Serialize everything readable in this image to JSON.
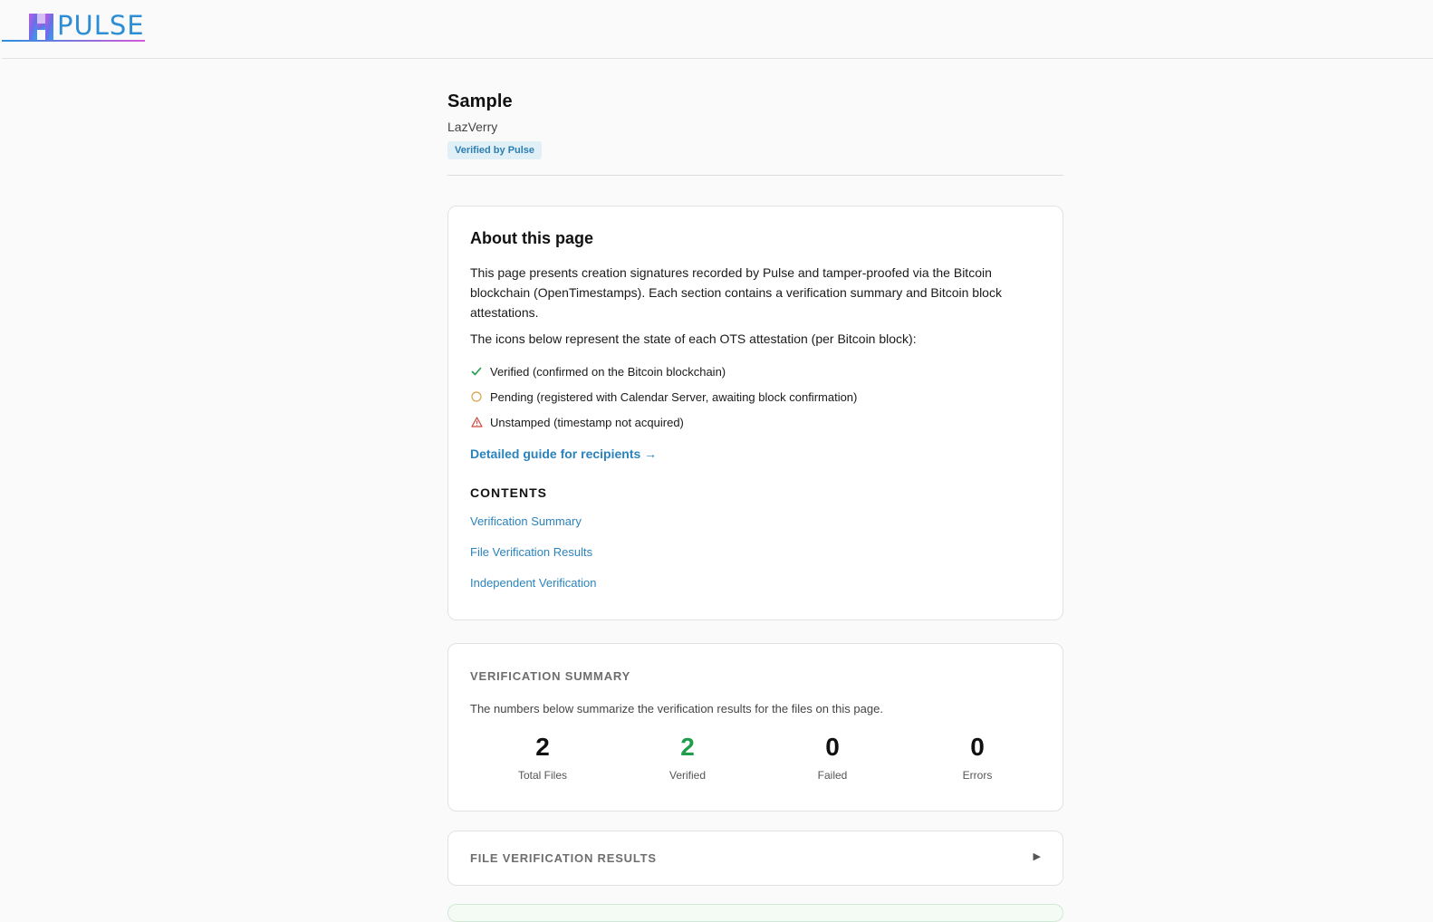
{
  "header": {
    "logo_text": "PULSE"
  },
  "page": {
    "title": "Sample",
    "author": "LazVerry",
    "badge": "Verified by Pulse"
  },
  "about": {
    "heading": "About this page",
    "paragraph": "This page presents creation signatures recorded by Pulse and tamper-proofed via the Bitcoin blockchain (OpenTimestamps). Each section contains a verification summary and Bitcoin block attestations.",
    "icons_intro": "The icons below represent the state of each OTS attestation (per Bitcoin block):",
    "legend": [
      {
        "icon": "check-icon",
        "text": "Verified (confirmed on the Bitcoin blockchain)",
        "color": "#1f9d4d"
      },
      {
        "icon": "pending-circle-icon",
        "text": "Pending (registered with Calendar Server, awaiting block confirmation)",
        "color": "#d9a24a"
      },
      {
        "icon": "warning-triangle-icon",
        "text": "Unstamped (timestamp not acquired)",
        "color": "#d0453b"
      }
    ],
    "guide_link": "Detailed guide for recipients →",
    "contents_title": "CONTENTS",
    "contents": [
      "Verification Summary",
      "File Verification Results",
      "Independent Verification"
    ]
  },
  "summary": {
    "label": "VERIFICATION SUMMARY",
    "description": "The numbers below summarize the verification results for the files on this page.",
    "stats": [
      {
        "value": "2",
        "label": "Total Files"
      },
      {
        "value": "2",
        "label": "Verified"
      },
      {
        "value": "0",
        "label": "Failed"
      },
      {
        "value": "0",
        "label": "Errors"
      }
    ]
  },
  "file_results": {
    "label": "FILE VERIFICATION RESULTS",
    "toggle_icon": "▶"
  },
  "colors": {
    "link": "#2b83bd",
    "verified_green": "#1f9d4d",
    "badge_bg": "#e1eff7"
  }
}
